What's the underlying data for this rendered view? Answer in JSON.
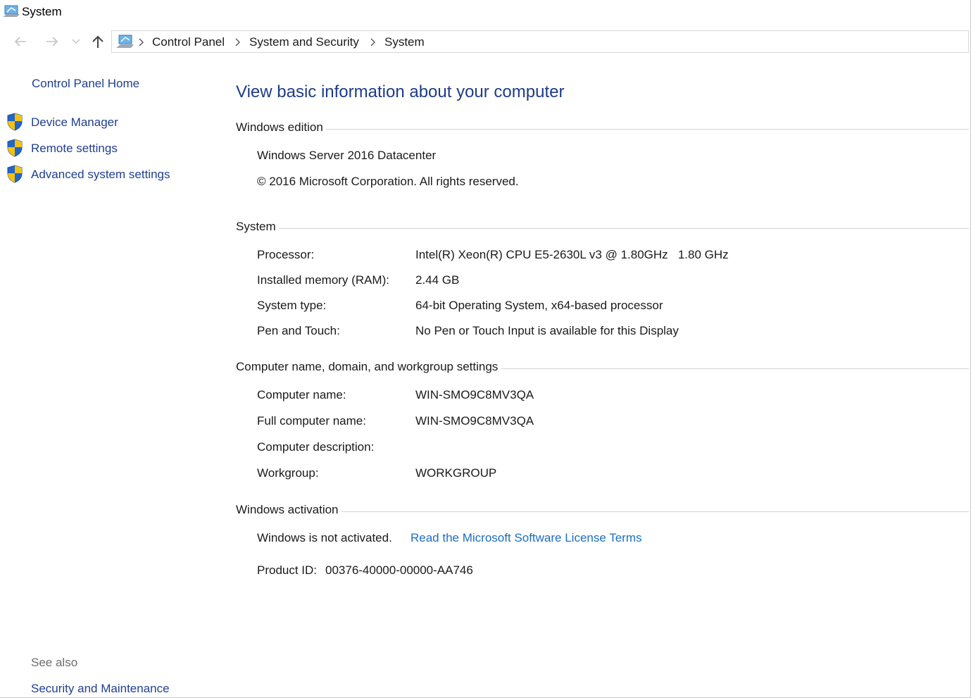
{
  "window": {
    "title": "System"
  },
  "breadcrumb": [
    "Control Panel",
    "System and Security",
    "System"
  ],
  "sidebar": {
    "home": "Control Panel Home",
    "items": [
      {
        "label": "Device Manager",
        "icon": "shield-icon"
      },
      {
        "label": "Remote settings",
        "icon": "shield-icon"
      },
      {
        "label": "Advanced system settings",
        "icon": "shield-icon"
      }
    ],
    "see_also_heading": "See also",
    "see_also_items": [
      "Security and Maintenance"
    ]
  },
  "main": {
    "page_title": "View basic information about your computer",
    "edition": {
      "heading": "Windows edition",
      "name": "Windows Server 2016 Datacenter",
      "copyright": "© 2016 Microsoft Corporation. All rights reserved."
    },
    "system": {
      "heading": "System",
      "rows": [
        {
          "label": "Processor:",
          "value": "Intel(R) Xeon(R) CPU E5-2630L v3 @ 1.80GHz   1.80 GHz"
        },
        {
          "label": "Installed memory (RAM):",
          "value": "2.44 GB"
        },
        {
          "label": "System type:",
          "value": "64-bit Operating System, x64-based processor"
        },
        {
          "label": "Pen and Touch:",
          "value": "No Pen or Touch Input is available for this Display"
        }
      ]
    },
    "computer_name": {
      "heading": "Computer name, domain, and workgroup settings",
      "rows": [
        {
          "label": "Computer name:",
          "value": "WIN-SMO9C8MV3QA"
        },
        {
          "label": "Full computer name:",
          "value": "WIN-SMO9C8MV3QA"
        },
        {
          "label": "Computer description:",
          "value": ""
        },
        {
          "label": "Workgroup:",
          "value": "WORKGROUP"
        }
      ]
    },
    "activation": {
      "heading": "Windows activation",
      "status": "Windows is not activated.",
      "license_link": "Read the Microsoft Software License Terms",
      "product_id_label": "Product ID:",
      "product_id": "00376-40000-00000-AA746"
    }
  },
  "colors": {
    "link": "#1f3f8f",
    "title": "#1e3c87",
    "hyperlink": "#1b6ec2",
    "shield_blue": "#2266c8",
    "shield_yellow": "#f2c111"
  }
}
